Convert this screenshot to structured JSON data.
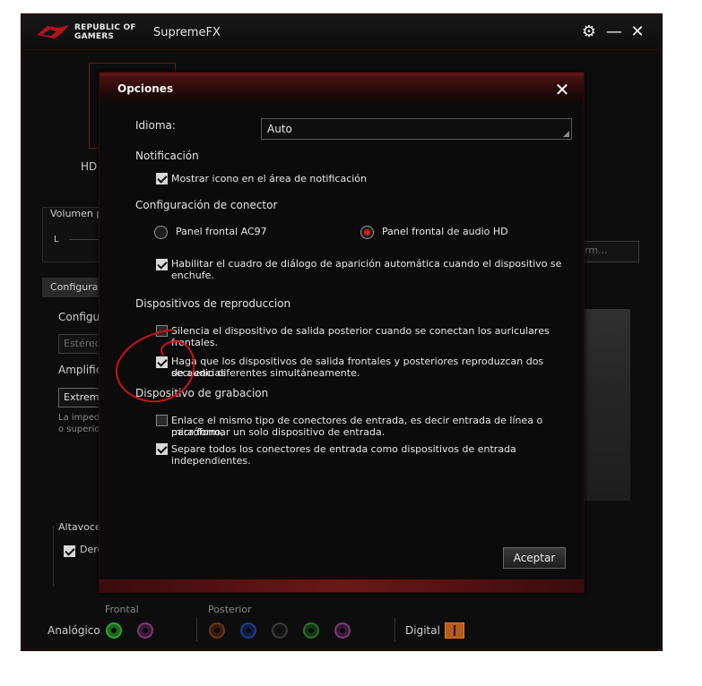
{
  "app": {
    "brand_line1": "REPUBLIC OF",
    "brand_line2": "GAMERS",
    "title": "SupremeFX"
  },
  "background": {
    "hd_label": "HD",
    "volume_label": "Volumen p",
    "volume_channel": "L",
    "term_text": "term...",
    "config_tab": "Configurac",
    "config_label": "Configur",
    "stereo_field": "Estéreo",
    "amplif_label": "Amplific",
    "extreme_field": "Extremo",
    "imped_line1": "La impedi",
    "imped_line2": "o superio",
    "altavoces_label": "Altavoce",
    "derecho_label": "Dere"
  },
  "bottom": {
    "frontal_label": "Frontal",
    "posterior_label": "Posterior",
    "analog_label": "Analógico",
    "digital_label": "Digital",
    "jack_colors": {
      "front_green": "#2a8a2a",
      "front_pink": "#8a3a7a",
      "rear_orange": "#7a3a1a",
      "rear_blue": "#1a3a9a",
      "rear_black": "#3a3a3a",
      "rear_green": "#2a7a2a",
      "rear_pink": "#8a3a7a"
    }
  },
  "dialog": {
    "title": "Opciones",
    "language_label": "Idioma:",
    "language_value": "Auto",
    "notification_heading": "Notificación",
    "notification_option": "Mostrar icono en el área de notificación",
    "connector_heading": "Configuración de conector",
    "radio_ac97": "Panel frontal AC97",
    "radio_hd": "Panel frontal de audio HD",
    "autopopup_line1": "Habilitar el cuadro de diálogo de aparición automática cuando el dispositivo se",
    "autopopup_line2": "enchufe.",
    "playback_heading": "Dispositivos de reproduccion",
    "mute_rear": "Silencia el dispositivo de salida posterior cuando se conectan los auriculares frontales.",
    "multistream_line1": "Haga que los dispositivos de salida frontales y posteriores reproduzcan dos secuencias",
    "multistream_line2": "de audio diferentes simultáneamente.",
    "recording_heading": "Dispositivo de grabacion",
    "join_inputs_line1": "Enlace el mismo tipo de conectores de entrada, es decir entrada de línea o micrófono,",
    "join_inputs_line2": "para formar un solo dispositivo de entrada.",
    "separate_inputs": "Separe todos los conectores de entrada como dispositivos de entrada independientes.",
    "accept_button": "Aceptar"
  },
  "state": {
    "notification_checked": true,
    "connector_selected": "HD",
    "autopopup_checked": true,
    "mute_rear_checked": false,
    "multistream_checked": true,
    "join_inputs_checked": false,
    "separate_inputs_checked": true,
    "derecho_checked": true
  },
  "colors": {
    "accent_red": "#d11a2a",
    "annotation_red": "#cc1111",
    "dialog_bg": "#0b0b0b"
  }
}
